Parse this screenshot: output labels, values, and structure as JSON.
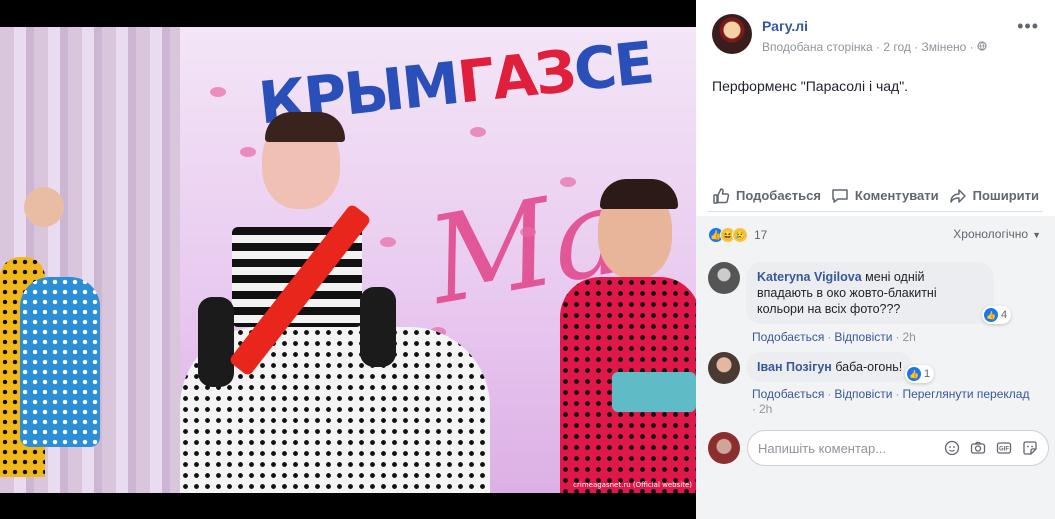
{
  "photo": {
    "banner_text_blue": "КРЫМ",
    "banner_text_red": "ГАЗ",
    "banner_text_rest": "СЕ",
    "script_text": "Ма",
    "watermark": "crimeagasnet.ru (Official website)"
  },
  "post": {
    "page_name": "Рагу.лі",
    "meta": "Вподобана сторінка · 2 год · Змінено · ",
    "text": "Перформенс \"Парасолі і чад\".",
    "more_icon": "more-dots-icon",
    "privacy_icon": "globe-icon"
  },
  "actions": {
    "like": "Подобається",
    "comment": "Коментувати",
    "share": "Поширити"
  },
  "reactions": {
    "count": "17",
    "order": "Хронологічно"
  },
  "comments": [
    {
      "author": "Kateryna Vigilova",
      "text": "мені одній впадають в око жовто-блакитні кольори на всіх фото???",
      "reaction_count": "4",
      "like": "Подобається",
      "reply": "Відповісти",
      "time": "2h"
    },
    {
      "author": "Іван Позігун",
      "text": "баба-огонь!",
      "reaction_count": "1",
      "like": "Подобається",
      "reply": "Відповісти",
      "translate": "Переглянути переклад",
      "time": "2h"
    }
  ],
  "composer": {
    "placeholder": "Напишіть коментар..."
  },
  "colors": {
    "link": "#365899",
    "like_blue": "#1877f2",
    "panel_bg": "#f2f3f5"
  }
}
